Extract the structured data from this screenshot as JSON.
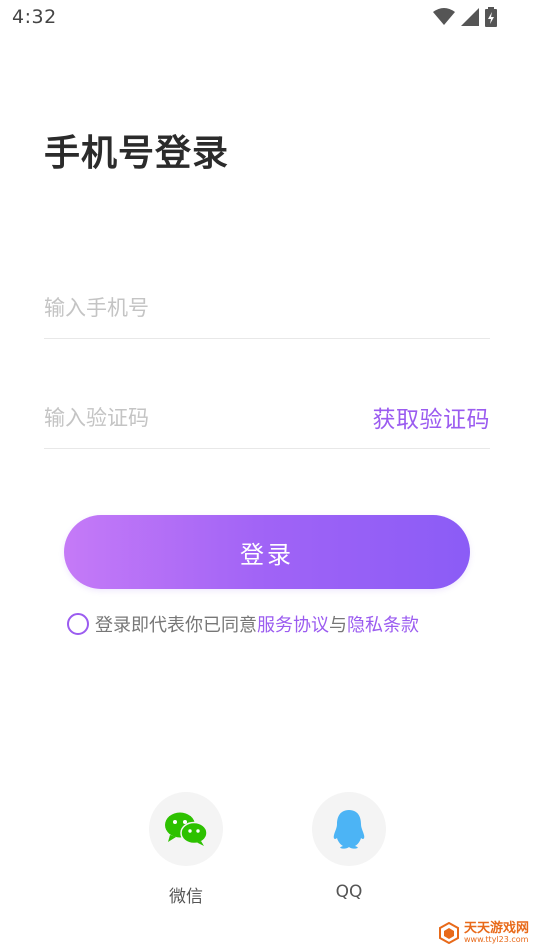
{
  "status_bar": {
    "time": "4:32"
  },
  "login": {
    "title": "手机号登录",
    "phone_placeholder": "输入手机号",
    "code_placeholder": "输入验证码",
    "get_code_label": "获取验证码",
    "submit_label": "登录"
  },
  "agreement": {
    "prefix": "登录即代表你已同意",
    "service_terms": "服务协议",
    "conjunction": "与",
    "privacy_terms": "隐私条款"
  },
  "social": {
    "wechat_label": "微信",
    "qq_label": "QQ"
  },
  "watermark": {
    "main": "天天游戏网",
    "sub": "www.ttyl23.com"
  },
  "colors": {
    "accent": "#9b5cf0",
    "button_gradient_start": "#c57af7",
    "button_gradient_end": "#8b5cf6",
    "wechat_green": "#2dc100",
    "qq_blue": "#4cb4f5"
  }
}
